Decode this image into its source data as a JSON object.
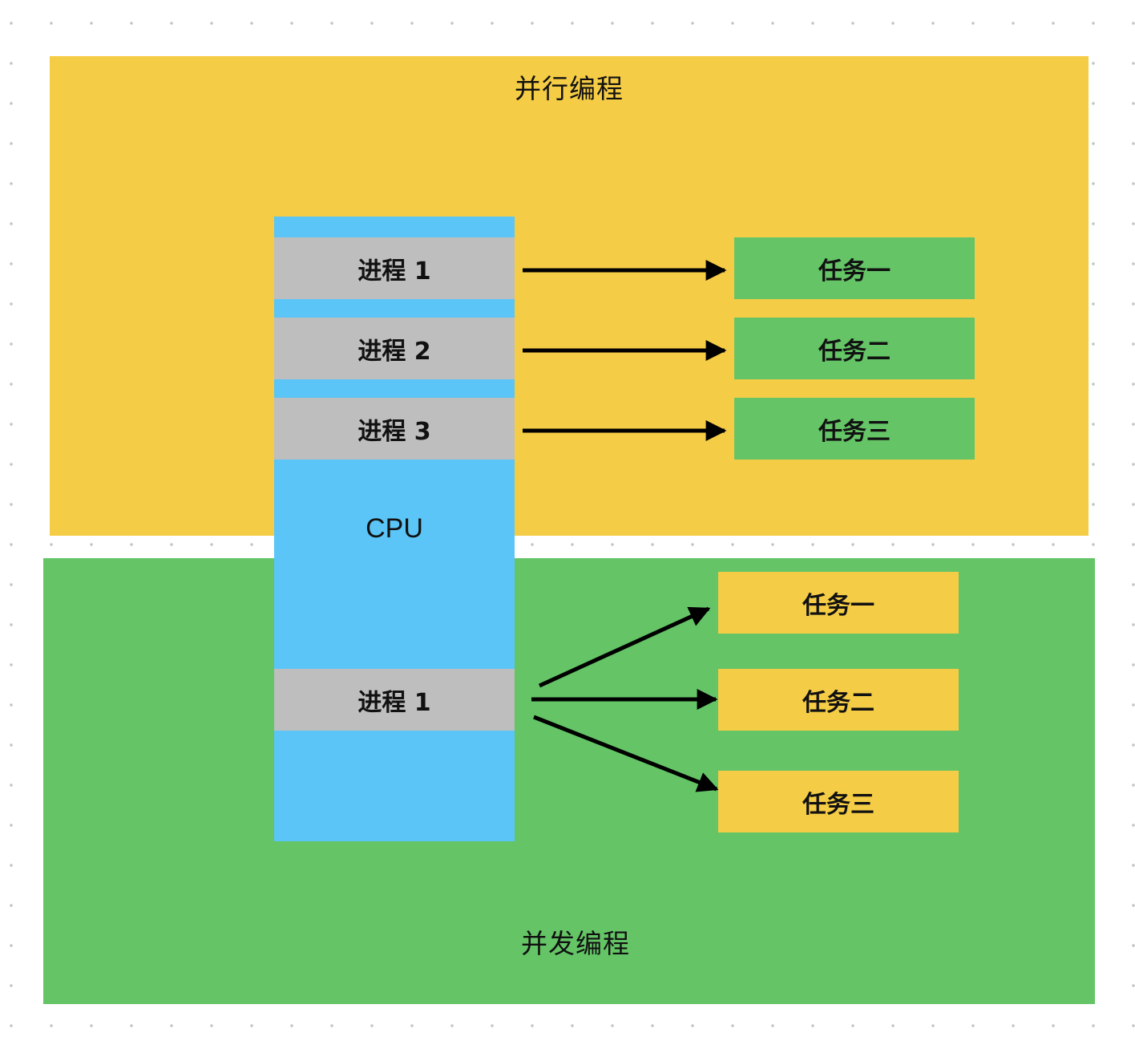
{
  "parallel": {
    "title": "并行编程",
    "processes": [
      "进程 1",
      "进程 2",
      "进程 3"
    ],
    "tasks": [
      "任务一",
      "任务二",
      "任务三"
    ]
  },
  "cpu": {
    "label": "CPU"
  },
  "concurrent": {
    "title": "并发编程",
    "process": "进程 1",
    "tasks": [
      "任务一",
      "任务二",
      "任务三"
    ]
  },
  "colors": {
    "parallel_bg": "#f5cc45",
    "concurrent_bg": "#64c466",
    "cpu": "#5ac5f6",
    "process": "#bebebe",
    "arrow": "#000000"
  }
}
